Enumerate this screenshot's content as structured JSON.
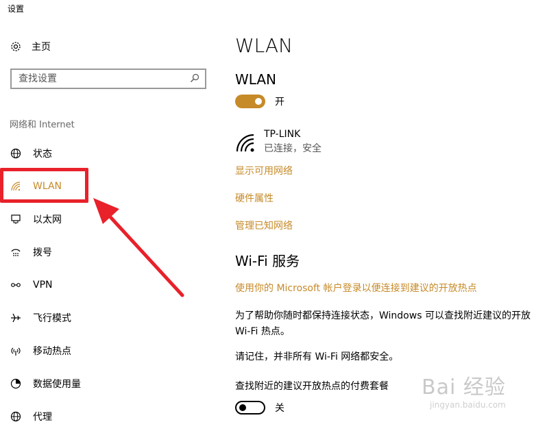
{
  "window": {
    "title": "设置"
  },
  "sidebar": {
    "home_label": "主页",
    "search_placeholder": "查找设置",
    "section_title": "网络和 Internet",
    "items": [
      {
        "label": "状态",
        "icon": "globe-icon"
      },
      {
        "label": "WLAN",
        "icon": "wifi-icon",
        "active": true
      },
      {
        "label": "以太网",
        "icon": "ethernet-icon"
      },
      {
        "label": "拨号",
        "icon": "dialup-icon"
      },
      {
        "label": "VPN",
        "icon": "vpn-icon"
      },
      {
        "label": "飞行模式",
        "icon": "airplane-icon"
      },
      {
        "label": "移动热点",
        "icon": "hotspot-icon"
      },
      {
        "label": "数据使用量",
        "icon": "data-usage-icon"
      },
      {
        "label": "代理",
        "icon": "proxy-globe-icon"
      }
    ]
  },
  "main": {
    "page_title": "WLAN",
    "wlan_heading": "WLAN",
    "wlan_toggle": {
      "state": "on",
      "label": "开"
    },
    "network": {
      "name": "TP-LINK",
      "status": "已连接，安全"
    },
    "links": [
      "显示可用网络",
      "硬件属性",
      "管理已知网络"
    ],
    "wifi_services": {
      "heading": "Wi-Fi 服务",
      "signin_link": "使用你的 Microsoft 帐户登录以便连接到建议的开放热点",
      "description": "为了帮助你随时都保持连接状态，Windows 可以查找附近建议的开放 Wi-Fi 热点。",
      "warning": "请记住，并非所有 Wi-Fi 网络都安全。",
      "paid_plans_label": "查找附近的建议开放热点的付费套餐",
      "paid_toggle": {
        "state": "off",
        "label": "关"
      }
    }
  },
  "watermark": {
    "big": "Bai 经验",
    "small": "jingyan.baidu.com"
  },
  "colors": {
    "accent": "#c68a28",
    "annotation": "#e8212a"
  }
}
